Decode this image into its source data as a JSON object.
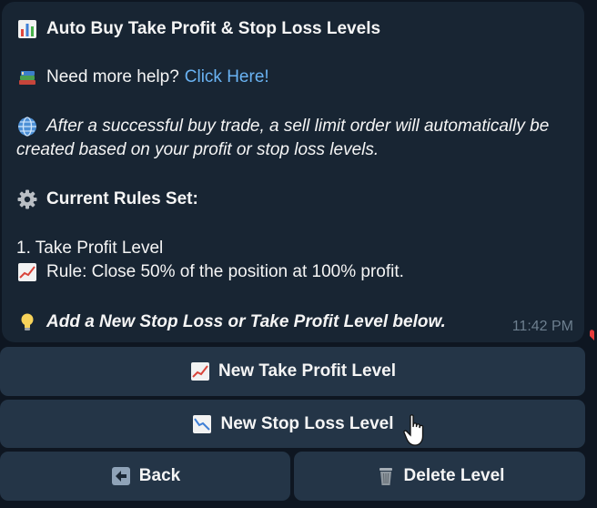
{
  "message": {
    "title": "Auto Buy Take Profit & Stop Loss Levels",
    "help_prefix": "Need more help?",
    "help_link": "Click Here!",
    "description_line1": "After a successful buy trade, a sell limit order will automatically be",
    "description_line2": "created based on your profit or stop loss levels.",
    "rules_heading": "Current Rules Set:",
    "rule_item_title": "1. Take Profit Level",
    "rule_item_text": "Rule: Close 50% of the position at 100% profit.",
    "hint": "Add a New Stop Loss or Take Profit Level below.",
    "timestamp": "11:42 PM"
  },
  "keyboard": {
    "new_take_profit": "New Take Profit Level",
    "new_stop_loss": "New Stop Loss Level",
    "back": "Back",
    "delete_level": "Delete Level"
  },
  "icons": {
    "title": "bar-chart-icon",
    "help": "books-icon",
    "description": "globe-icon",
    "rules": "gear-icon",
    "rule_item": "chart-increasing-icon",
    "hint": "lightbulb-icon",
    "take_profit": "chart-increasing-icon",
    "stop_loss": "chart-decreasing-icon",
    "back": "back-arrow-icon",
    "delete": "wastebasket-icon"
  },
  "colors": {
    "background": "#0e1621",
    "bubble": "#182533",
    "button": "#243547",
    "link": "#6ab3f3",
    "timestamp": "#6d7f8f",
    "text": "#f5f5f5"
  }
}
